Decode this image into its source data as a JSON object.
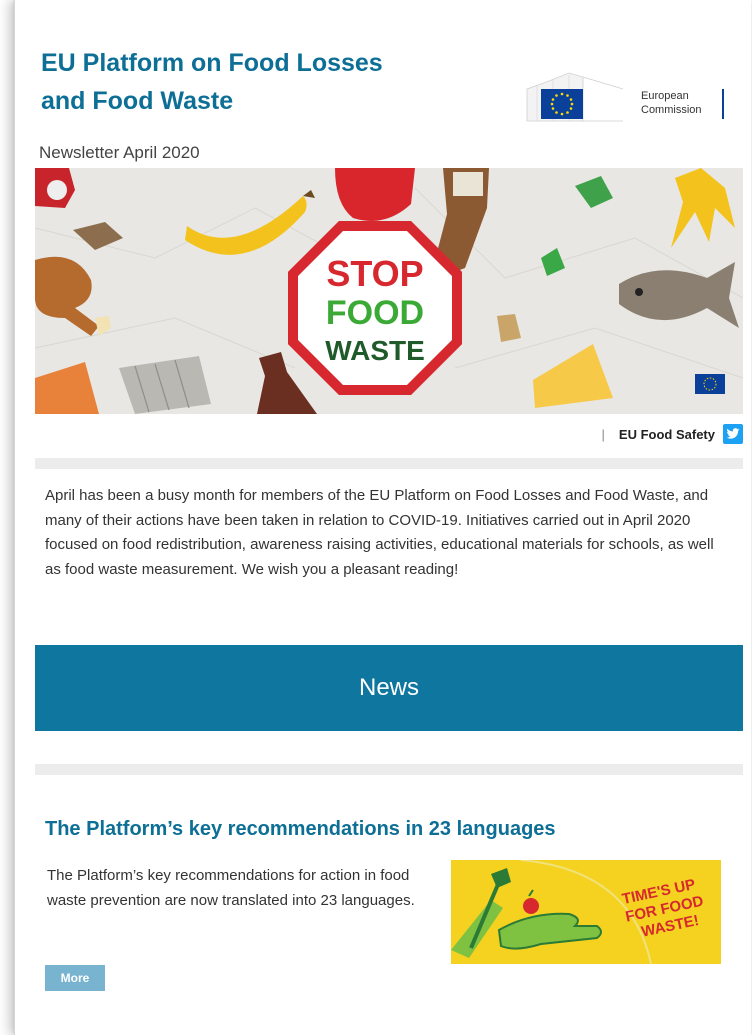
{
  "header": {
    "title_line1": "EU Platform on Food Losses",
    "title_line2": "and Food Waste",
    "logo_text_1": "European",
    "logo_text_2": "Commission",
    "newsletter_date": "Newsletter April 2020"
  },
  "hero": {
    "sign_line1": "STOP",
    "sign_line2": "FOOD",
    "sign_line3": "WASTE"
  },
  "social": {
    "separator": "|",
    "label": "EU Food Safety",
    "icon": "twitter-icon"
  },
  "intro": {
    "text": "April has been a busy month for members of the EU Platform on Food Losses and Food Waste, and many of their actions have been taken in relation to COVID-19. Initiatives carried out in April 2020 focused on food redistribution, awareness raising activities, educational materials for schools, as well as food waste measurement. We wish you a pleasant reading!"
  },
  "news": {
    "heading": "News"
  },
  "article": {
    "title": "The Platform’s key recommendations in 23 languages",
    "text": "The Platform’s key recommendations for action in food waste prevention are now translated into 23 languages.",
    "image_line1": "TIME'S UP",
    "image_line2": "FOR FOOD",
    "image_line3": "WASTE!",
    "more_label": "More"
  },
  "colors": {
    "brand_blue": "#0d6f96",
    "news_band": "#0f76a0",
    "more_button": "#78b3cf",
    "twitter": "#1da1f2",
    "sign_red": "#d7282f",
    "sign_green": "#3aa935",
    "image_yellow": "#f5d21f"
  }
}
